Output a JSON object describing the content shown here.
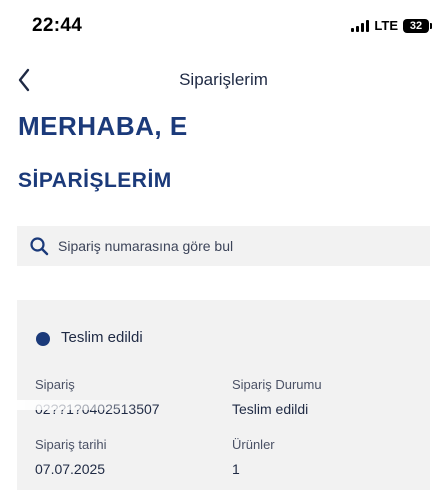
{
  "status_bar": {
    "time": "22:44",
    "network": "LTE",
    "battery": "32"
  },
  "nav": {
    "title": "Siparişlerim",
    "back_icon": "chevron-left-icon"
  },
  "greeting": {
    "text": "MERHABA, E"
  },
  "section_title": "SİPARİŞLERİM",
  "search": {
    "placeholder": "Sipariş numarasına göre bul",
    "value": "",
    "icon": "search-icon"
  },
  "orders": [
    {
      "status": "Teslim edildi",
      "status_color": "#1b3a7a",
      "order_label": "Sipariş",
      "order_number": "02??1?0402513507",
      "state_label": "Sipariş Durumu",
      "state_value": "Teslim edildi",
      "date_label": "Sipariş tarihi",
      "date_value": "07.07.2025",
      "items_label": "Ürünler",
      "items_value": "1"
    }
  ],
  "colors": {
    "primary": "#1b3a7a",
    "surface": "#f2f2f2",
    "text": "#1f2a44"
  }
}
